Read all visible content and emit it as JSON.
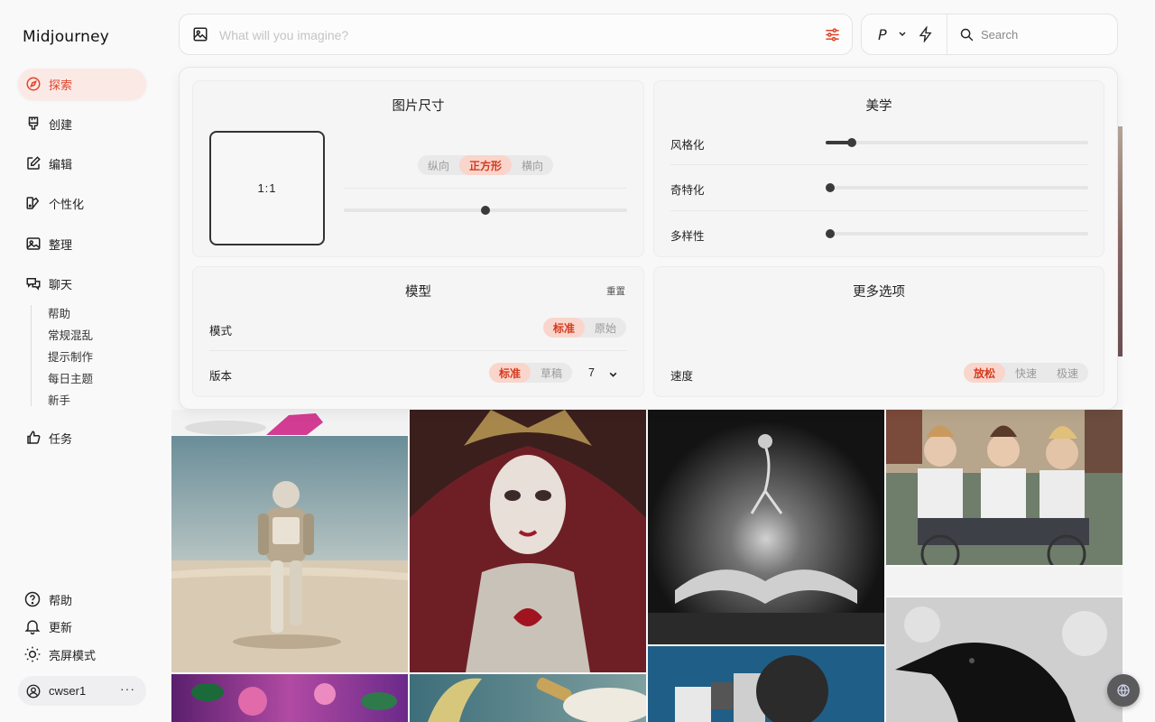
{
  "app": {
    "logo": "Midjourney"
  },
  "sidebar": {
    "items": [
      {
        "label": "探索",
        "icon": "compass-icon",
        "active": true
      },
      {
        "label": "创建",
        "icon": "brush-icon"
      },
      {
        "label": "编辑",
        "icon": "edit-icon"
      },
      {
        "label": "个性化",
        "icon": "personalize-icon"
      },
      {
        "label": "整理",
        "icon": "image-icon"
      },
      {
        "label": "聊天",
        "icon": "chat-icon"
      }
    ],
    "chat_sub": [
      "帮助",
      "常规混乱",
      "提示制作",
      "每日主题",
      "新手"
    ],
    "tasks": {
      "label": "任务",
      "icon": "thumbs-up-icon"
    },
    "bottom": [
      {
        "label": "帮助",
        "icon": "help-icon"
      },
      {
        "label": "更新",
        "icon": "bell-icon"
      },
      {
        "label": "亮屏模式",
        "icon": "sun-icon"
      }
    ],
    "user": {
      "name": "cwser1",
      "more": "···"
    }
  },
  "prompt": {
    "placeholder": "What will you imagine?",
    "value": ""
  },
  "toolbar": {
    "p_label": "P",
    "search_placeholder": "Search"
  },
  "panel": {
    "image_size": {
      "title": "图片尺寸",
      "ratio": "1:1",
      "orientation": [
        "纵向",
        "正方形",
        "横向"
      ],
      "orientation_selected": "正方形",
      "ratio_slider": 0.5
    },
    "aesthetics": {
      "title": "美学",
      "sliders": [
        {
          "label": "风格化",
          "value": 0.1
        },
        {
          "label": "奇特化",
          "value": 0.0
        },
        {
          "label": "多样性",
          "value": 0.0
        }
      ]
    },
    "model": {
      "title": "模型",
      "reset": "重置",
      "mode_label": "模式",
      "mode_options": [
        "标准",
        "原始"
      ],
      "mode_selected": "标准",
      "version_label": "版本",
      "version_options": [
        "标准",
        "草稿"
      ],
      "version_selected": "标准",
      "version_value": "7"
    },
    "more": {
      "title": "更多选项",
      "speed_label": "速度",
      "speed_options": [
        "放松",
        "快速",
        "极速"
      ],
      "speed_selected": "放松"
    }
  },
  "colors": {
    "accent": "#e0452c",
    "accent_bg": "#fad5cc"
  }
}
